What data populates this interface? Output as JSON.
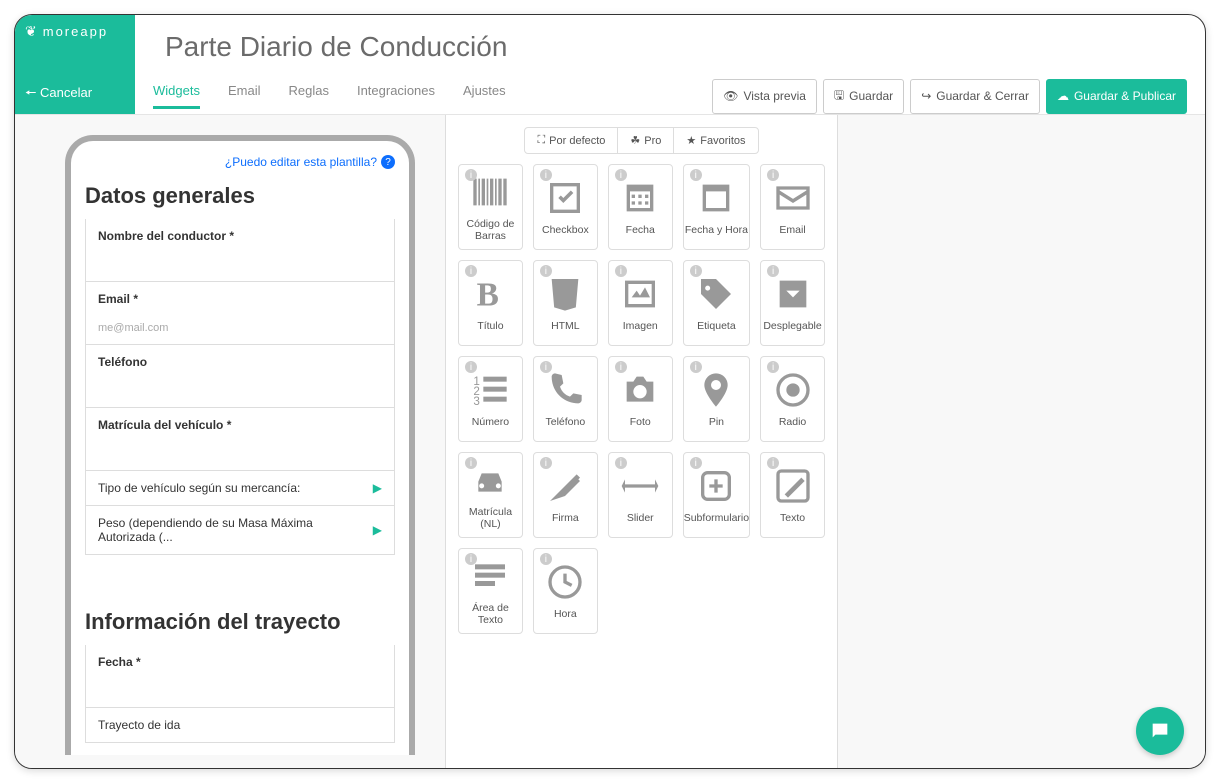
{
  "brand": "moreapp",
  "cancel": "Cancelar",
  "title": "Parte Diario de Conducción",
  "tabs": {
    "widgets": "Widgets",
    "email": "Email",
    "reglas": "Reglas",
    "integraciones": "Integraciones",
    "ajustes": "Ajustes"
  },
  "actions": {
    "preview": "Vista previa",
    "save": "Guardar",
    "saveClose": "Guardar & Cerrar",
    "savePublish": "Guardar & Publicar"
  },
  "hint": "¿Puedo editar esta plantilla?",
  "form": {
    "section1": "Datos generales",
    "f1": "Nombre del conductor *",
    "f2": "Email *",
    "f2ph": "me@mail.com",
    "f3": "Teléfono",
    "f4": "Matrícula del vehículo *",
    "f5": "Tipo de vehículo según su mercancía:",
    "f6": "Peso (dependiendo de su Masa Máxima Autorizada (...",
    "section2": "Información del trayecto",
    "f7": "Fecha *",
    "f8": "Trayecto de ida"
  },
  "filters": {
    "default": "Por defecto",
    "pro": "Pro",
    "fav": "Favoritos"
  },
  "widgets": {
    "barcode": "Código de Barras",
    "checkbox": "Checkbox",
    "date": "Fecha",
    "datetime": "Fecha y Hora",
    "email": "Email",
    "title": "Título",
    "html": "HTML",
    "image": "Imagen",
    "tag": "Etiqueta",
    "dropdown": "Desplegable",
    "number": "Número",
    "phone": "Teléfono",
    "photo": "Foto",
    "pin": "Pin",
    "radio": "Radio",
    "plate": "Matrícula (NL)",
    "signature": "Firma",
    "slider": "Slider",
    "subform": "Subformulario",
    "text": "Texto",
    "textarea": "Área de Texto",
    "time": "Hora"
  }
}
